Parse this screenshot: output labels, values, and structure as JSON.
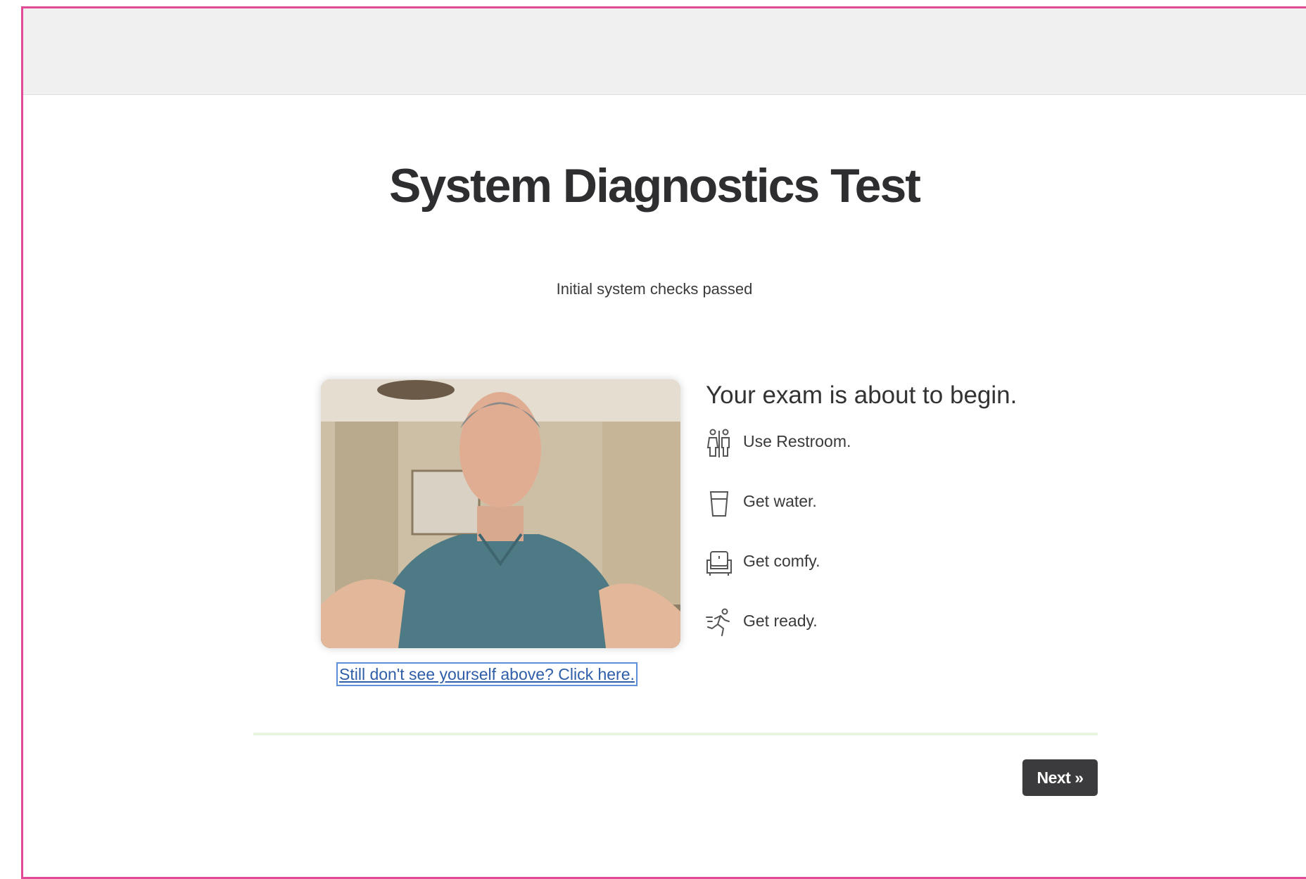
{
  "page": {
    "title": "System Diagnostics Test",
    "status": "Initial system checks passed"
  },
  "webcam": {
    "help_link": "Still don't see yourself above? Click here."
  },
  "checklist": {
    "heading": "Your exam is about to begin.",
    "items": [
      {
        "icon": "restroom-icon",
        "label": "Use Restroom."
      },
      {
        "icon": "water-glass-icon",
        "label": "Get water."
      },
      {
        "icon": "armchair-icon",
        "label": "Get comfy."
      },
      {
        "icon": "runner-icon",
        "label": "Get ready."
      }
    ]
  },
  "footer": {
    "next_label": "Next »"
  },
  "colors": {
    "frame_border": "#e04a97",
    "topbar_bg": "#f1f0f0",
    "button_bg": "#3b3b3d",
    "link": "#2f5ea8",
    "divider": "#e9f5df"
  }
}
